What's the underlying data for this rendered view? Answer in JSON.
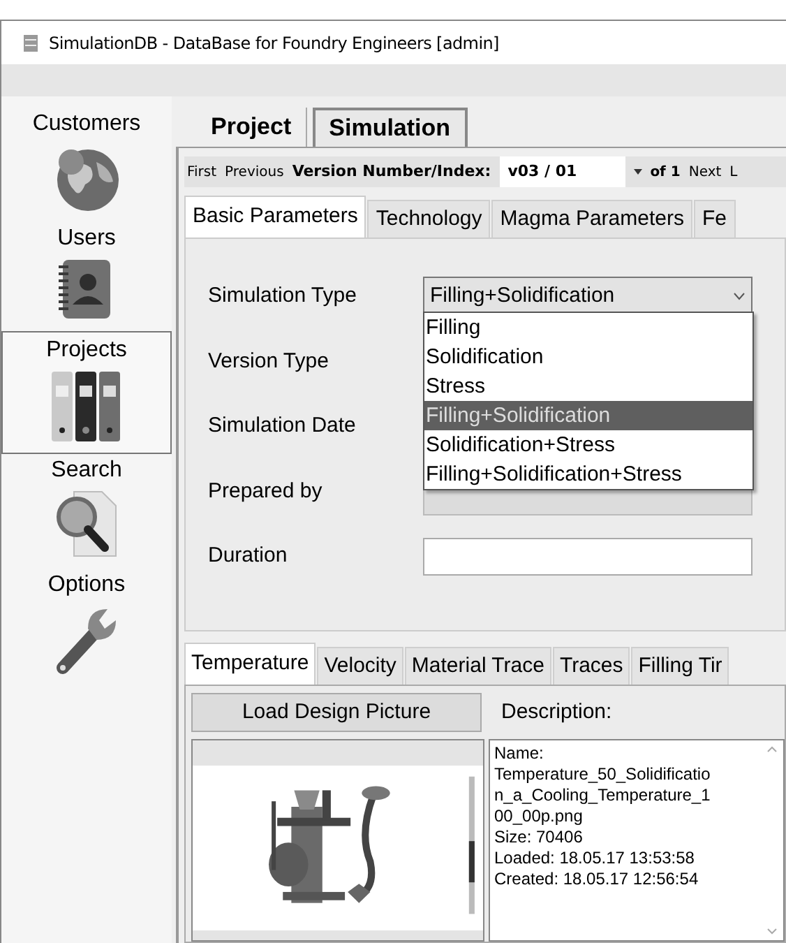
{
  "window": {
    "title": "SimulationDB - DataBase for Foundry Engineers [admin]"
  },
  "sidebar": {
    "items": [
      {
        "label": "Customers",
        "kind": "globe",
        "selected": false
      },
      {
        "label": "Users",
        "kind": "contacts",
        "selected": false
      },
      {
        "label": "Projects",
        "kind": "binders",
        "selected": true
      },
      {
        "label": "Search",
        "kind": "search",
        "selected": false
      },
      {
        "label": "Options",
        "kind": "wrench",
        "selected": false
      }
    ]
  },
  "top_tabs": [
    {
      "label": "Project",
      "selected": false
    },
    {
      "label": "Simulation",
      "selected": true
    }
  ],
  "navigator": {
    "first": "First",
    "previous": "Previous",
    "label": "Version Number/Index:",
    "value": "v03 / 01",
    "of_count": "of 1",
    "next": "Next",
    "last": "L"
  },
  "param_tabs": [
    {
      "label": "Basic Parameters",
      "selected": true
    },
    {
      "label": "Technology",
      "selected": false
    },
    {
      "label": "Magma Parameters",
      "selected": false
    },
    {
      "label": "Fe",
      "selected": false
    }
  ],
  "form": {
    "fields": [
      {
        "label": "Simulation Type",
        "kind": "combo",
        "value": "Filling+Solidification"
      },
      {
        "label": "Version Type",
        "kind": "covered"
      },
      {
        "label": "Simulation Date",
        "kind": "covered"
      },
      {
        "label": "Prepared by",
        "kind": "readonly"
      },
      {
        "label": "Duration",
        "kind": "text"
      }
    ]
  },
  "dropdown": {
    "options": [
      {
        "label": "Filling",
        "selected": false
      },
      {
        "label": "Solidification",
        "selected": false
      },
      {
        "label": "Stress",
        "selected": false
      },
      {
        "label": "Filling+Solidification",
        "selected": true
      },
      {
        "label": "Solidification+Stress",
        "selected": false
      },
      {
        "label": "Filling+Solidification+Stress",
        "selected": false
      }
    ]
  },
  "result_tabs": [
    {
      "label": "Temperature",
      "selected": true
    },
    {
      "label": "Velocity",
      "selected": false
    },
    {
      "label": "Material Trace",
      "selected": false
    },
    {
      "label": "Traces",
      "selected": false
    },
    {
      "label": "Filling Tir",
      "selected": false
    }
  ],
  "load_button": "Load Design Picture",
  "description_label": "Description:",
  "description_lines": [
    "Name:",
    "Temperature_50_Solidificatio",
    "n_a_Cooling_Temperature_1",
    "00_00p.png",
    "Size: 70406",
    "Loaded: 18.05.17 13:53:58",
    "Created: 18.05.17 12:56:54"
  ]
}
